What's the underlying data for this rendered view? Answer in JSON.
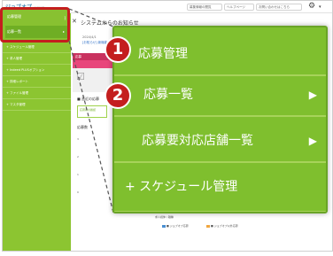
{
  "header": {
    "logo_text": "ジョブオプ",
    "logo_sub": "採用管理",
    "buttons": [
      "募集情報の閲覧",
      "ヘルプページ",
      "お問い合わせはこちら"
    ],
    "gear_icon": "gear-icon"
  },
  "sidebar": {
    "items": [
      {
        "label": "応募管理"
      },
      {
        "label": "応募一覧",
        "arrow": "▸"
      },
      {
        "label": "+ スケジュール管理"
      },
      {
        "label": "+ 求人管理"
      },
      {
        "label": "+ Indeed PLUSオプション"
      },
      {
        "label": "+ 詳細レポート"
      },
      {
        "label": "+ ファイル管理"
      },
      {
        "label": "+ マスタ管理"
      }
    ]
  },
  "main": {
    "notice_title": "システムからのお知らせ",
    "notice_date": "2024/4/1",
    "notice_link": "[お知らせ] 新機能",
    "card_label": "応募",
    "card_icon": "checklist-icon",
    "section_title": "■ 直近の応募",
    "section_box": "応募者の確認",
    "list_label": "応募数",
    "axis_labels": [
      "3",
      "2",
      "1",
      "0"
    ],
    "chart_notes": [
      "求人媒体 / 職種",
      "■ ジョブオプ応募",
      "■ ジョブオプ以外応募"
    ]
  },
  "zoom_panel": {
    "items": [
      {
        "label": "応募管理",
        "badge": "1"
      },
      {
        "label": "応募一覧",
        "badge": "2",
        "arrow": "▶"
      },
      {
        "label": "応募要対応店舗一覧",
        "arrow": "▶"
      },
      {
        "label": "+ スケジュール管理"
      }
    ]
  },
  "colors": {
    "sidebar_green": "#8cc531",
    "active_green": "#6fae24",
    "highlight_red": "#c41e1e",
    "card_pink": "#e8467b"
  }
}
